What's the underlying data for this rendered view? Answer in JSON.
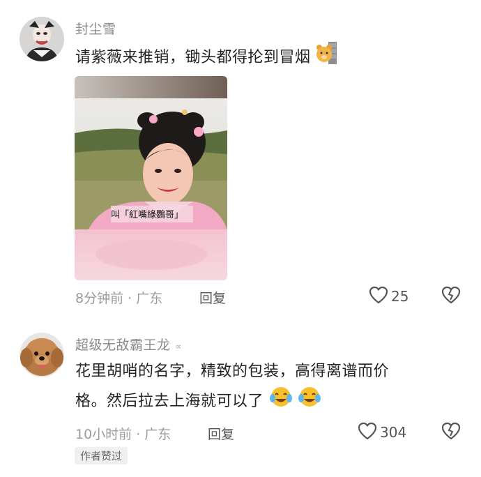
{
  "comments": [
    {
      "username": "封尘雪",
      "text": "请紫薇来推销，锄头都得抡到冒烟",
      "image_caption": "叫「紅嘴綠鸚哥」",
      "meta": "8分钟前 · 广东",
      "reply_label": "回复",
      "likes": "25"
    },
    {
      "username": "超级无敌霸王龙",
      "username_suffix": "∝",
      "text_line1": "花里胡哨的名字，精致的包装，高得离谱而价",
      "text_line2": "格。然后拉去上海就可以了",
      "meta": "10小时前 · 广东",
      "reply_label": "回复",
      "likes": "304",
      "author_badge": "作者赞过"
    }
  ],
  "colors": {
    "username": "#8a8a8a",
    "meta": "#9a9a9a",
    "text": "#222222",
    "badge_bg": "#f0f0f0"
  },
  "icons": [
    "heart-outline-icon",
    "broken-heart-icon",
    "bear-emoji-icon",
    "crying-laughing-emoji-icon"
  ]
}
